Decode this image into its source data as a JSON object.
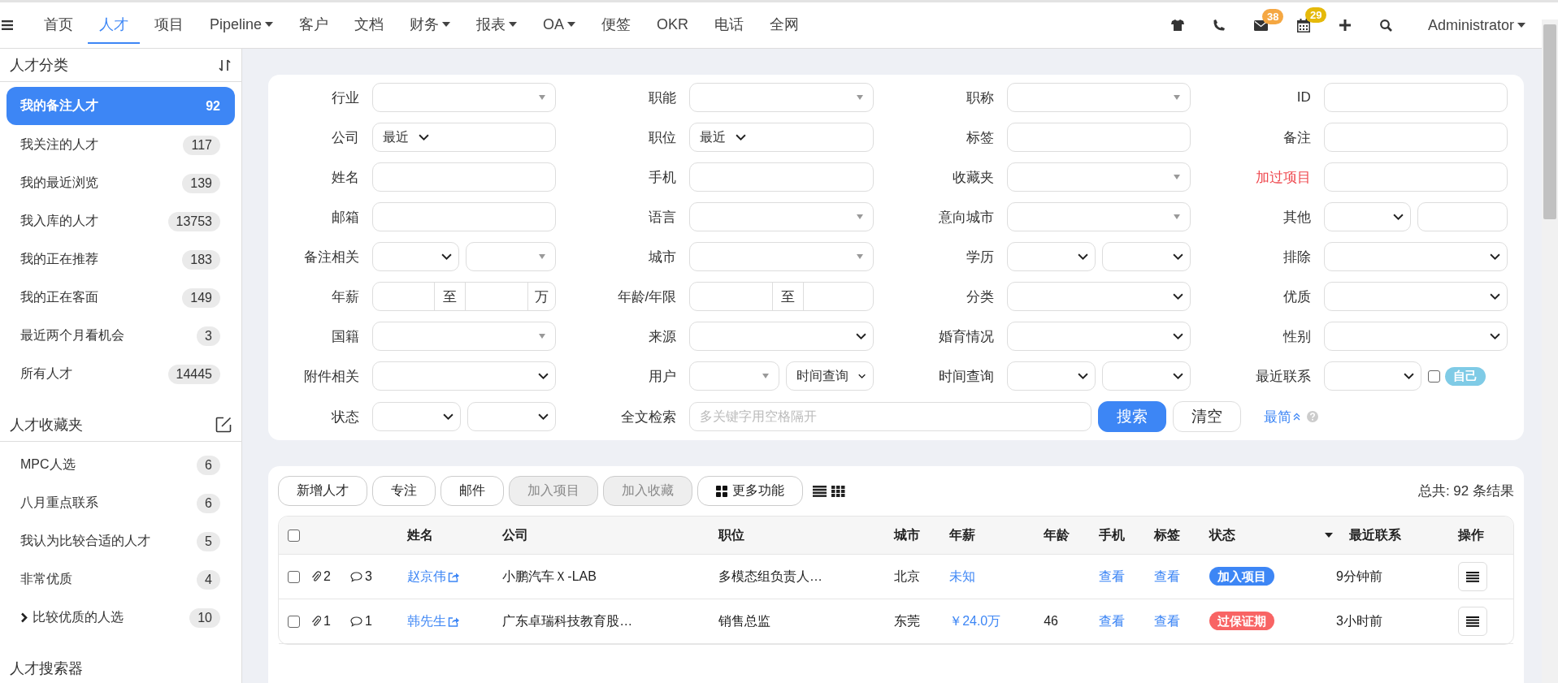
{
  "nav": {
    "items": [
      {
        "label": "首页",
        "dropdown": false,
        "selected": false
      },
      {
        "label": "人才",
        "dropdown": false,
        "selected": true
      },
      {
        "label": "项目",
        "dropdown": false,
        "selected": false
      },
      {
        "label": "Pipeline",
        "dropdown": true,
        "selected": false
      },
      {
        "label": "客户",
        "dropdown": false,
        "selected": false
      },
      {
        "label": "文档",
        "dropdown": false,
        "selected": false
      },
      {
        "label": "财务",
        "dropdown": true,
        "selected": false
      },
      {
        "label": "报表",
        "dropdown": true,
        "selected": false
      },
      {
        "label": "OA",
        "dropdown": true,
        "selected": false
      },
      {
        "label": "便签",
        "dropdown": false,
        "selected": false
      },
      {
        "label": "OKR",
        "dropdown": false,
        "selected": false
      },
      {
        "label": "电话",
        "dropdown": false,
        "selected": false
      },
      {
        "label": "全网",
        "dropdown": false,
        "selected": false
      }
    ],
    "tools": [
      {
        "kind": "shirt"
      },
      {
        "kind": "phone"
      },
      {
        "kind": "mail",
        "badge": "38",
        "color": "#f5a742"
      },
      {
        "kind": "calendar",
        "badge": "29",
        "color": "#e5b90a"
      },
      {
        "kind": "plus"
      },
      {
        "kind": "search"
      }
    ],
    "user": "Administrator"
  },
  "sidebar": {
    "sections": [
      {
        "title": "人才分类",
        "kind": "sort",
        "items": [
          {
            "label": "我的备注人才",
            "count": "92",
            "selected": true,
            "expandable": false
          },
          {
            "label": "我关注的人才",
            "count": "117",
            "selected": false,
            "expandable": false
          },
          {
            "label": "我的最近浏览",
            "count": "139",
            "selected": false,
            "expandable": false
          },
          {
            "label": "我入库的人才",
            "count": "13753",
            "selected": false,
            "expandable": false
          },
          {
            "label": "我的正在推荐",
            "count": "183",
            "selected": false,
            "expandable": false
          },
          {
            "label": "我的正在客面",
            "count": "149",
            "selected": false,
            "expandable": false
          },
          {
            "label": "最近两个月看机会",
            "count": "3",
            "selected": false,
            "expandable": false
          },
          {
            "label": "所有人才",
            "count": "14445",
            "selected": false,
            "expandable": false
          }
        ]
      },
      {
        "title": "人才收藏夹",
        "kind": "edit",
        "items": [
          {
            "label": "MPC人选",
            "count": "6",
            "selected": false,
            "expandable": false
          },
          {
            "label": "八月重点联系",
            "count": "6",
            "selected": false,
            "expandable": false
          },
          {
            "label": "我认为比较合适的人才",
            "count": "5",
            "selected": false,
            "expandable": false
          },
          {
            "label": "非常优质",
            "count": "4",
            "selected": false,
            "expandable": false
          },
          {
            "label": "比较优质的人选",
            "count": "10",
            "selected": false,
            "expandable": true
          }
        ]
      },
      {
        "title": "人才搜索器"
      }
    ]
  },
  "filters": {
    "fields": [
      {
        "label": "行业",
        "highlighted": false,
        "controls": [
          {
            "kind": "select"
          }
        ]
      },
      {
        "label": "职能",
        "highlighted": false,
        "controls": [
          {
            "kind": "select"
          }
        ]
      },
      {
        "label": "职称",
        "highlighted": false,
        "controls": [
          {
            "kind": "select"
          }
        ]
      },
      {
        "label": "ID",
        "highlighted": false,
        "controls": [
          {
            "kind": "text"
          }
        ]
      },
      {
        "label": "公司",
        "highlighted": false,
        "controls": [
          {
            "kind": "recent",
            "value": "最近"
          }
        ]
      },
      {
        "label": "职位",
        "highlighted": false,
        "controls": [
          {
            "kind": "recent",
            "value": "最近"
          }
        ]
      },
      {
        "label": "标签",
        "highlighted": false,
        "controls": [
          {
            "kind": "text"
          }
        ]
      },
      {
        "label": "备注",
        "highlighted": false,
        "controls": [
          {
            "kind": "text"
          }
        ]
      },
      {
        "label": "姓名",
        "highlighted": false,
        "controls": [
          {
            "kind": "text"
          }
        ]
      },
      {
        "label": "手机",
        "highlighted": false,
        "controls": [
          {
            "kind": "text"
          }
        ]
      },
      {
        "label": "收藏夹",
        "highlighted": false,
        "controls": [
          {
            "kind": "select"
          }
        ]
      },
      {
        "label": "加过项目",
        "highlighted": true,
        "controls": [
          {
            "kind": "text"
          }
        ]
      },
      {
        "label": "邮箱",
        "highlighted": false,
        "controls": [
          {
            "kind": "text"
          }
        ]
      },
      {
        "label": "语言",
        "highlighted": false,
        "controls": [
          {
            "kind": "select"
          }
        ]
      },
      {
        "label": "意向城市",
        "highlighted": false,
        "controls": [
          {
            "kind": "select"
          }
        ]
      },
      {
        "label": "其他",
        "highlighted": false,
        "controls": [
          {
            "kind": "chevron"
          },
          {
            "kind": "text"
          }
        ]
      },
      {
        "label": "备注相关",
        "highlighted": false,
        "controls": [
          {
            "kind": "chevron"
          },
          {
            "kind": "select"
          }
        ]
      },
      {
        "label": "城市",
        "highlighted": false,
        "controls": [
          {
            "kind": "select"
          }
        ]
      },
      {
        "label": "学历",
        "highlighted": false,
        "controls": [
          {
            "kind": "chevron"
          },
          {
            "kind": "chevron"
          }
        ]
      },
      {
        "label": "排除",
        "highlighted": false,
        "controls": [
          {
            "kind": "chevron"
          }
        ]
      },
      {
        "label": "年薪",
        "highlighted": false,
        "controls": [
          {
            "kind": "range",
            "separator": "至",
            "unit": "万"
          }
        ]
      },
      {
        "label": "年龄/年限",
        "highlighted": false,
        "controls": [
          {
            "kind": "range",
            "separator": "至"
          }
        ]
      },
      {
        "label": "分类",
        "highlighted": false,
        "controls": [
          {
            "kind": "chevron"
          }
        ]
      },
      {
        "label": "优质",
        "highlighted": false,
        "controls": [
          {
            "kind": "chevron"
          }
        ]
      },
      {
        "label": "国籍",
        "highlighted": false,
        "controls": [
          {
            "kind": "select"
          }
        ]
      },
      {
        "label": "来源",
        "highlighted": false,
        "controls": [
          {
            "kind": "chevron"
          }
        ]
      },
      {
        "label": "婚育情况",
        "highlighted": false,
        "controls": [
          {
            "kind": "chevron"
          }
        ]
      },
      {
        "label": "性别",
        "highlighted": false,
        "controls": [
          {
            "kind": "chevron"
          }
        ]
      },
      {
        "label": "附件相关",
        "highlighted": false,
        "controls": [
          {
            "kind": "chevron"
          }
        ]
      },
      {
        "label": "用户",
        "highlighted": false,
        "controls": [
          {
            "kind": "select"
          },
          {
            "kind": "chevron",
            "value": "时间查询"
          }
        ]
      },
      {
        "label": "时间查询",
        "highlighted": false,
        "controls": [
          {
            "kind": "chevron"
          },
          {
            "kind": "chevron"
          }
        ]
      },
      {
        "label": "最近联系",
        "highlighted": false,
        "controls": [
          {
            "kind": "chevron"
          },
          {
            "kind": "checkbox",
            "checked": false,
            "tag": "自己"
          }
        ]
      },
      {
        "label": "状态",
        "highlighted": false,
        "controls": [
          {
            "kind": "chevron"
          },
          {
            "kind": "chevron"
          }
        ]
      }
    ],
    "fulltext": {
      "label": "全文检索",
      "placeholder": "多关键字用空格隔开"
    },
    "search_button": "搜索",
    "clear_button": "清空",
    "simple_link": "最简"
  },
  "results": {
    "toolbar": [
      {
        "label": "新增人才",
        "disabled": false,
        "icon": false
      },
      {
        "label": "专注",
        "disabled": false,
        "icon": false
      },
      {
        "label": "邮件",
        "disabled": false,
        "icon": false
      },
      {
        "label": "加入项目",
        "disabled": true,
        "icon": false
      },
      {
        "label": "加入收藏",
        "disabled": true,
        "icon": false
      },
      {
        "label": "更多功能",
        "disabled": false,
        "icon": true
      }
    ],
    "total": "总共: 92 条结果",
    "columns": [
      "姓名",
      "公司",
      "职位",
      "城市",
      "年薪",
      "年龄",
      "手机",
      "标签",
      "状态",
      "最近联系",
      "操作"
    ],
    "all_checked": false,
    "rows": [
      {
        "checked": false,
        "attachments": "2",
        "comments": "3",
        "name": "赵京伟",
        "company": "小鹏汽车Ｘ-LAB",
        "position": "多模态组负责人…",
        "city": "北京",
        "salary": "未知",
        "phone": "查看",
        "tag": "查看",
        "status": "加入项目",
        "color": "#3d86f5",
        "last_contact": "9分钟前"
      },
      {
        "checked": false,
        "attachments": "1",
        "comments": "1",
        "name": "韩先生",
        "company": "广东卓瑞科技教育股…",
        "position": "销售总监",
        "city": "东莞",
        "salary": "￥24.0万",
        "age": "46",
        "phone": "查看",
        "tag": "查看",
        "status": "过保证期",
        "color": "#f86464",
        "last_contact": "3小时前"
      }
    ]
  }
}
